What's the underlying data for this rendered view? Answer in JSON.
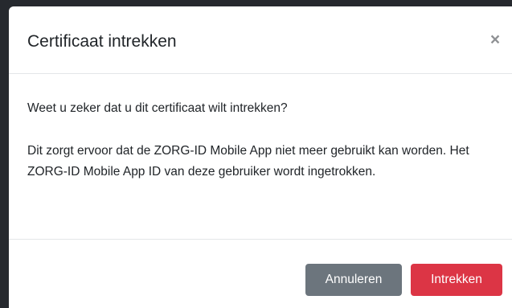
{
  "modal": {
    "title": "Certificaat intrekken",
    "close_label": "×",
    "body": {
      "question": "Weet u zeker dat u dit certificaat wilt intrekken?",
      "info": "Dit zorgt ervoor dat de ZORG-ID Mobile App niet meer gebruikt kan worden. Het ZORG-ID Mobile App ID van deze gebruiker wordt ingetrokken."
    },
    "footer": {
      "cancel_label": "Annuleren",
      "revoke_label": "Intrekken"
    }
  },
  "colors": {
    "backdrop": "#26292e",
    "cancel_button": "#6c757d",
    "revoke_button": "#dc3545"
  }
}
